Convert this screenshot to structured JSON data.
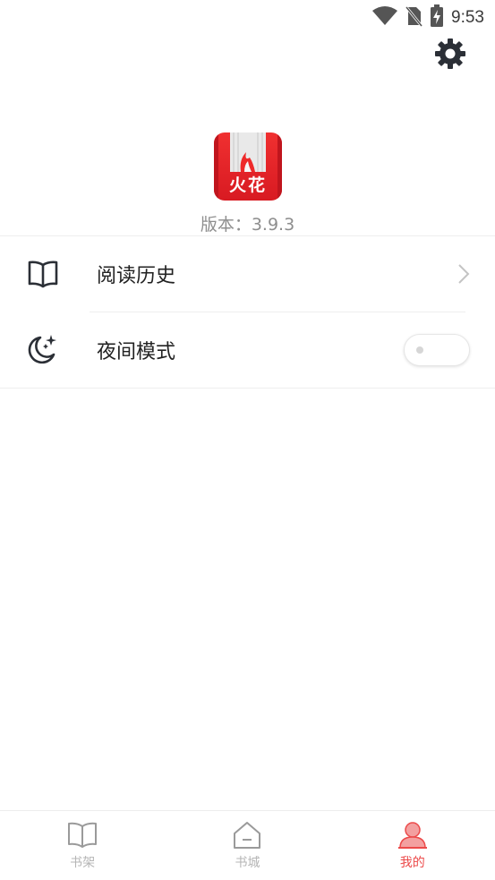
{
  "status_bar": {
    "time": "9:53",
    "icons": [
      "wifi-icon",
      "no-sim-icon",
      "battery-charging-icon"
    ]
  },
  "header": {
    "settings_icon": "gear-icon"
  },
  "app": {
    "logo_text": "火花",
    "version_label": "版本：3.9.3"
  },
  "menu": {
    "reading_history": {
      "label": "阅读历史",
      "icon": "book-open-icon"
    },
    "night_mode": {
      "label": "夜间模式",
      "icon": "moon-stars-icon",
      "enabled": false
    }
  },
  "bottom_nav": {
    "items": [
      {
        "label": "书架",
        "icon": "bookshelf-icon",
        "active": false
      },
      {
        "label": "书城",
        "icon": "home-icon",
        "active": false
      },
      {
        "label": "我的",
        "icon": "user-icon",
        "active": true
      }
    ]
  },
  "colors": {
    "accent": "#ec4a4a",
    "inactive": "#b5b5b5",
    "icon_dark": "#2b2f36",
    "logo_red": "#e8242b"
  }
}
